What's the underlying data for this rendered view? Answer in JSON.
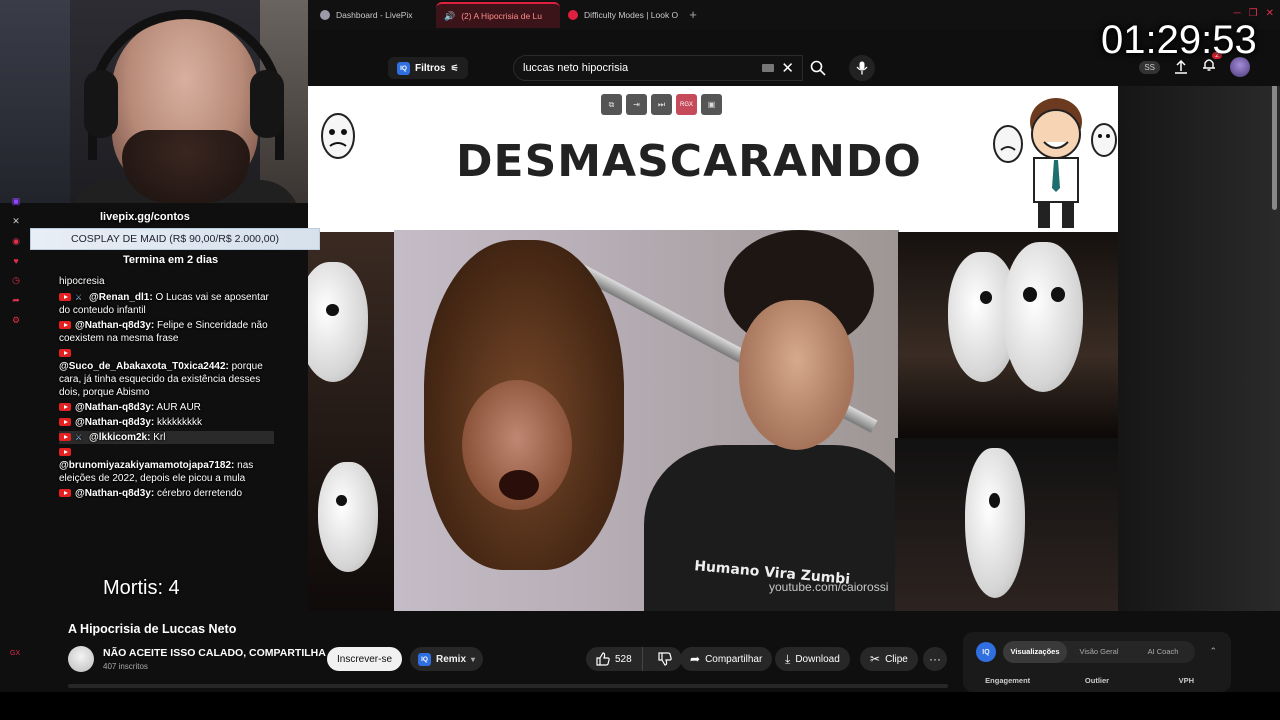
{
  "browser": {
    "tabs": [
      {
        "label": "Dashboard - LivePix",
        "active": false,
        "favicon_color": "#9a9aa8"
      },
      {
        "label": "(2) A Hipocrisia de Lu",
        "active": true,
        "favicon_color": "#e02020"
      },
      {
        "label": "Difficulty Modes | Look O",
        "active": false,
        "favicon_color": "#e02040"
      }
    ],
    "new_tab_label": "+"
  },
  "stream_timer": "01:29:53",
  "youtube_header": {
    "filters_label": "Filtros",
    "search_value": "luccas neto hipocrisia",
    "ss_label": "SS",
    "notifications_count": "2"
  },
  "stream_overlay": {
    "livepix_url": "livepix.gg/contos",
    "goal_text": "COSPLAY DE MAID (R$ 90,00/R$ 2.000,00)",
    "goal_ends": "Termina em 2 dias",
    "deaths_text": "Mortis: 4"
  },
  "chat": {
    "topic": "hipocresia",
    "messages": [
      {
        "user": "@Renan_dl1:",
        "text": "O Lucas vai se aposentar do conteudo infantil",
        "mod": true,
        "break": false
      },
      {
        "user": "@Nathan-q8d3y:",
        "text": "Felipe e Sinceridade não coexistem na mesma frase",
        "mod": false,
        "break": false
      },
      {
        "user": "@Suco_de_Abakaxota_T0xica2442:",
        "text": "porque cara, já tinha esquecido da existência desses dois, porque Abismo",
        "mod": false,
        "break": true
      },
      {
        "user": "@Nathan-q8d3y:",
        "text": "AUR AUR",
        "mod": false,
        "break": false
      },
      {
        "user": "@Nathan-q8d3y:",
        "text": "kkkkkkkkk",
        "mod": false,
        "break": false
      },
      {
        "user": "@lkkicom2k:",
        "text": "Krl",
        "mod": true,
        "break": false,
        "highlight": true
      },
      {
        "user": "@brunomiyazakiyamamotojapa7182:",
        "text": "nas eleições de 2022, depois ele picou a mula",
        "mod": false,
        "break": true
      },
      {
        "user": "@Nathan-q8d3y:",
        "text": "cérebro derretendo",
        "mod": false,
        "break": false
      }
    ]
  },
  "video": {
    "overlay_title": "DESMASCARANDO",
    "ctrl_rgx_label": "RGX",
    "shirt_text": "Humano Vira Zumbi",
    "watermark": "youtube.com/caiorossi"
  },
  "video_info": {
    "title": "A Hipocrisia de Luccas Neto",
    "channel_name": "NÃO ACEITE ISSO CALADO, COMPARTILHA",
    "subscribers": "407 inscritos",
    "subscribe_label": "Inscrever-se",
    "remix_label": "Remix",
    "like_count": "528",
    "share_label": "Compartilhar",
    "download_label": "Download",
    "clip_label": "Clipe",
    "more_label": "···"
  },
  "iq_panel": {
    "logo": "IQ",
    "tabs": [
      {
        "label": "Visualizações",
        "active": true
      },
      {
        "label": "Visão Geral",
        "active": false
      },
      {
        "label": "AI Coach",
        "active": false
      }
    ],
    "columns": [
      "Engagement",
      "Outlier",
      "VPH"
    ]
  },
  "side_label": "GX"
}
